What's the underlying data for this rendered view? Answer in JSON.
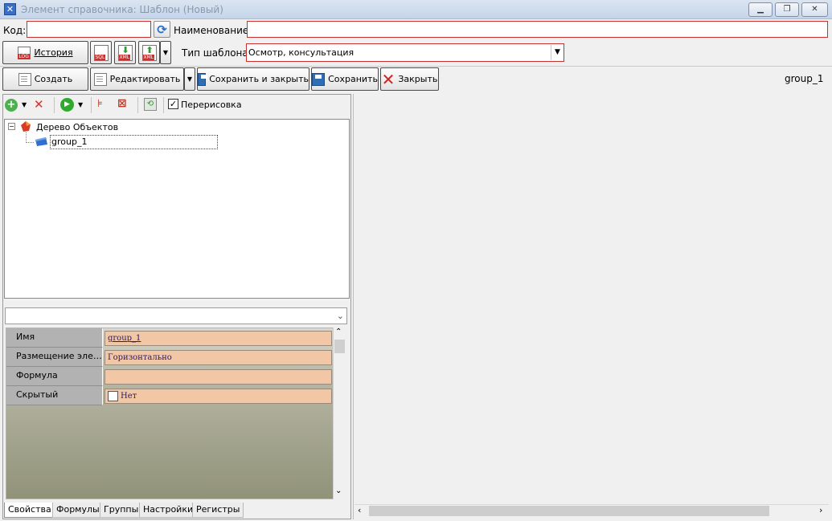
{
  "window": {
    "title": "Элемент справочника: Шаблон (Новый)",
    "minimize_icon": "minimize-icon",
    "restore_icon": "restore-icon",
    "close_icon": "close-icon"
  },
  "header": {
    "code_label": "Код:",
    "code_value": "",
    "name_label": "Наименование:",
    "name_value": "",
    "template_type_label": "Тип шаблона:",
    "template_type_value": "Осмотр, консультация"
  },
  "toolbar_top": {
    "history_label": "История",
    "sql_badge": "SQL",
    "xml_badge": "XML"
  },
  "toolbar_main": {
    "create_label": "Создать",
    "edit_label": "Редактировать",
    "save_close_label": "Сохранить и закрыть",
    "save_label": "Сохранить",
    "close_label": "Закрыть",
    "current_item": "group_1"
  },
  "tree_toolbar": {
    "redraw_label": "Перерисовка",
    "redraw_checked": true
  },
  "tree": {
    "root_label": "Дерево Объектов",
    "expander": "⊟",
    "children": [
      {
        "label": "group_1"
      }
    ]
  },
  "properties": {
    "selector_value": "",
    "rows": [
      {
        "name": "Имя",
        "value": "group_1"
      },
      {
        "name": "Размещение элементов",
        "name_display": "Размещение элеме...",
        "value": "Горизонтально"
      },
      {
        "name": "Формула",
        "value": ""
      },
      {
        "name": "Скрытый",
        "value": "Нет",
        "checkbox": false
      }
    ]
  },
  "tabs": [
    {
      "label": "Свойства",
      "active": true
    },
    {
      "label": "Формулы",
      "active": false
    },
    {
      "label": "Группы",
      "active": false
    },
    {
      "label": "Настройки",
      "active": false
    },
    {
      "label": "Регистры",
      "active": false
    }
  ],
  "colors": {
    "required_border": "#c9302f",
    "property_value_bg": "#f1c7a5",
    "property_name_bg": "#b2b2b2"
  }
}
